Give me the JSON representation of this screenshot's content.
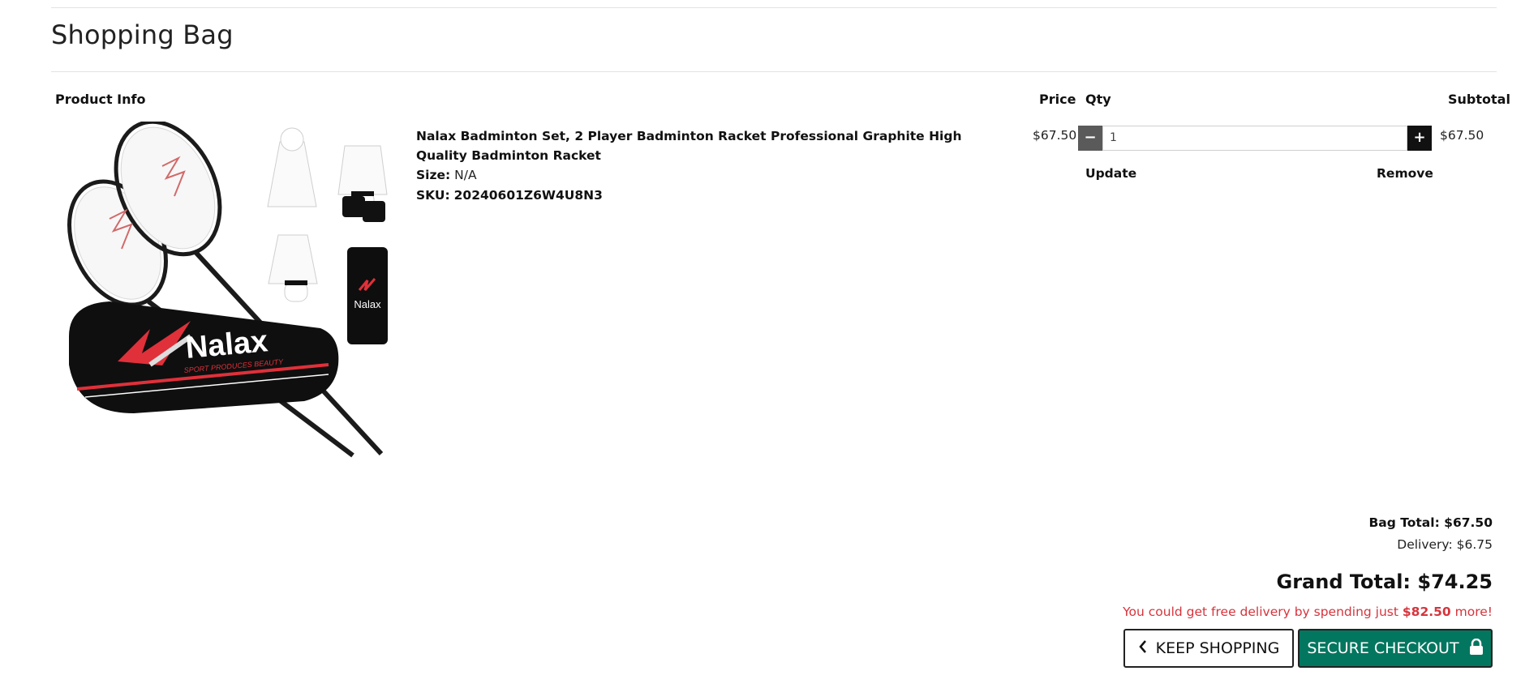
{
  "page": {
    "title": "Shopping Bag"
  },
  "table": {
    "headers": {
      "product_info": "Product Info",
      "price": "Price",
      "qty": "Qty",
      "subtotal": "Subtotal"
    }
  },
  "item": {
    "name": "Nalax Badminton Set, 2 Player Badminton Racket Professional Graphite High Quality Badminton Racket",
    "size_label": "Size:",
    "size_value": "N/A",
    "sku_label": "SKU:",
    "sku_value": "20240601Z6W4U8N3",
    "price": "$67.50",
    "quantity": "1",
    "subtotal": "$67.50",
    "update_label": "Update",
    "remove_label": "Remove",
    "image_brand": "Nalax",
    "image_tagline": "SPORT PRODUCES BEAUTY"
  },
  "summary": {
    "bag_total": "Bag Total: $67.50",
    "delivery": "Delivery: $6.75",
    "grand_total": "Grand Total: $74.25",
    "free_delivery_prefix": "You could get free delivery by spending just ",
    "free_delivery_amount": "$82.50",
    "free_delivery_suffix": " more!"
  },
  "buttons": {
    "keep_shopping": "KEEP SHOPPING",
    "secure_checkout": "SECURE CHECKOUT"
  },
  "colors": {
    "checkout_bg": "#03765f",
    "alert": "#d6343c"
  }
}
